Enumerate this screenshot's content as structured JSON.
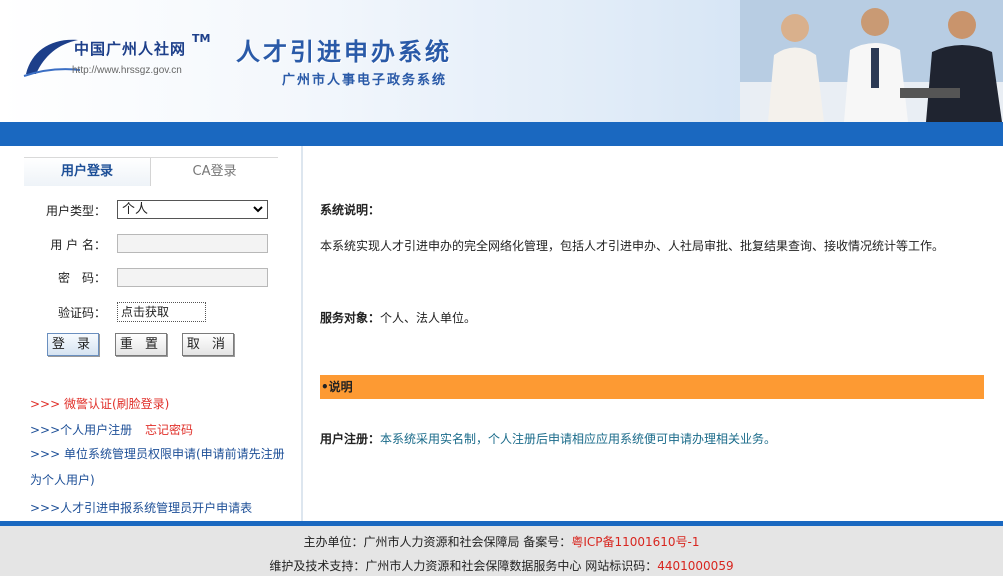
{
  "header": {
    "logo_text": "中国广州人社网",
    "logo_tm": "TM",
    "logo_url": "http://www.hrssgz.gov.cn",
    "system_title": "人才引进申办系统",
    "system_subtitle": "广州市人事电子政务系统"
  },
  "login": {
    "tabs": [
      "用户登录",
      "CA登录"
    ],
    "user_type_label": "用户类型：",
    "user_type_value": "个人",
    "username_label": "用 户 名：",
    "password_label": "密　码：",
    "captcha_label": "验证码：",
    "captcha_value": "点击获取",
    "buttons": {
      "login": "登 录",
      "reset": "重 置",
      "cancel": "取 消"
    }
  },
  "links": {
    "police_auth": ">>> 微警认证(刷脸登录)",
    "personal_register": ">>>个人用户注册",
    "forgot_password": "忘记密码",
    "unit_admin_apply": ">>> 单位系统管理员权限申请(申请前请先注册为个人用户)",
    "admin_account_form": ">>>人才引进申报系统管理员开户申请表"
  },
  "content": {
    "desc_label": "系统说明：",
    "desc_text": "本系统实现人才引进申办的完全网络化管理，包括人才引进申办、人社局审批、批复结果查询、接收情况统计等工作。",
    "target_label": "服务对象：",
    "target_text": "个人、法人单位。",
    "note_bar": "•说明",
    "register_label": "用户注册：",
    "register_text": "本系统采用实名制，个人注册后申请相应应用系统便可申请办理相关业务。"
  },
  "footer": {
    "line1_prefix": "主办单位：广州市人力资源和社会保障局 备案号：",
    "line1_icp": "粤ICP备11001610号-1",
    "line2_prefix": "维护及技术支持：广州市人力资源和社会保障数据服务中心 网站标识码：",
    "line2_code": "4401000059"
  },
  "colors": {
    "brand_blue": "#1a68c0",
    "note_orange": "#fd9a33",
    "link_red": "#e0302a",
    "link_blue": "#1d4f97"
  }
}
